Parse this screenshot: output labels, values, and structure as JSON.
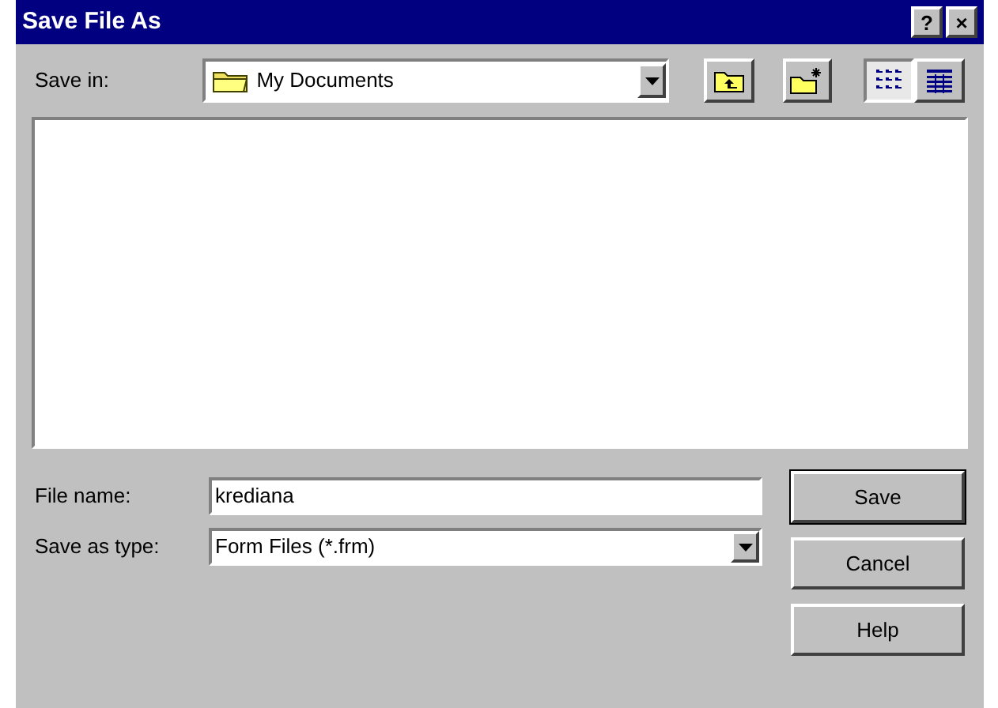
{
  "window": {
    "title": "Save File As",
    "title_buttons": [
      "?",
      "×"
    ]
  },
  "save_in": {
    "label": "Save in:",
    "value": "My Documents"
  },
  "views": [
    {
      "kind": "list",
      "selected": true
    },
    {
      "kind": "details",
      "selected": false
    }
  ],
  "file_name": {
    "label": "File name:",
    "value": "krediana"
  },
  "save_as_type": {
    "label": "Save as type:",
    "value": "Form Files (*.frm)"
  },
  "buttons": [
    {
      "label": "Save",
      "default": true
    },
    {
      "label": "Cancel",
      "default": false
    },
    {
      "label": "Help",
      "default": false
    }
  ]
}
